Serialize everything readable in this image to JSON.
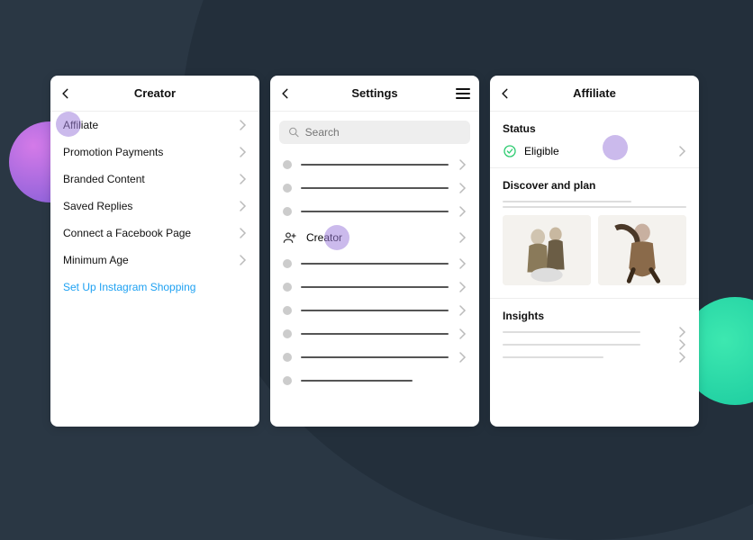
{
  "phone1": {
    "title": "Creator",
    "items": [
      {
        "label": "Affiliate",
        "highlighted": true
      },
      {
        "label": "Promotion Payments"
      },
      {
        "label": "Branded Content"
      },
      {
        "label": "Saved Replies"
      },
      {
        "label": "Connect a Facebook Page"
      },
      {
        "label": "Minimum Age"
      },
      {
        "label": "Set Up Instagram Shopping",
        "link": true
      }
    ]
  },
  "phone2": {
    "title": "Settings",
    "search_placeholder": "Search",
    "creator_label": "Creator"
  },
  "phone3": {
    "title": "Affiliate",
    "status_label": "Status",
    "status_value": "Eligible",
    "discover_label": "Discover and plan",
    "insights_label": "Insights"
  },
  "colors": {
    "link": "#1ea1f2",
    "highlight": "rgba(160,130,220,0.55)",
    "eligible": "#2ecc71"
  }
}
